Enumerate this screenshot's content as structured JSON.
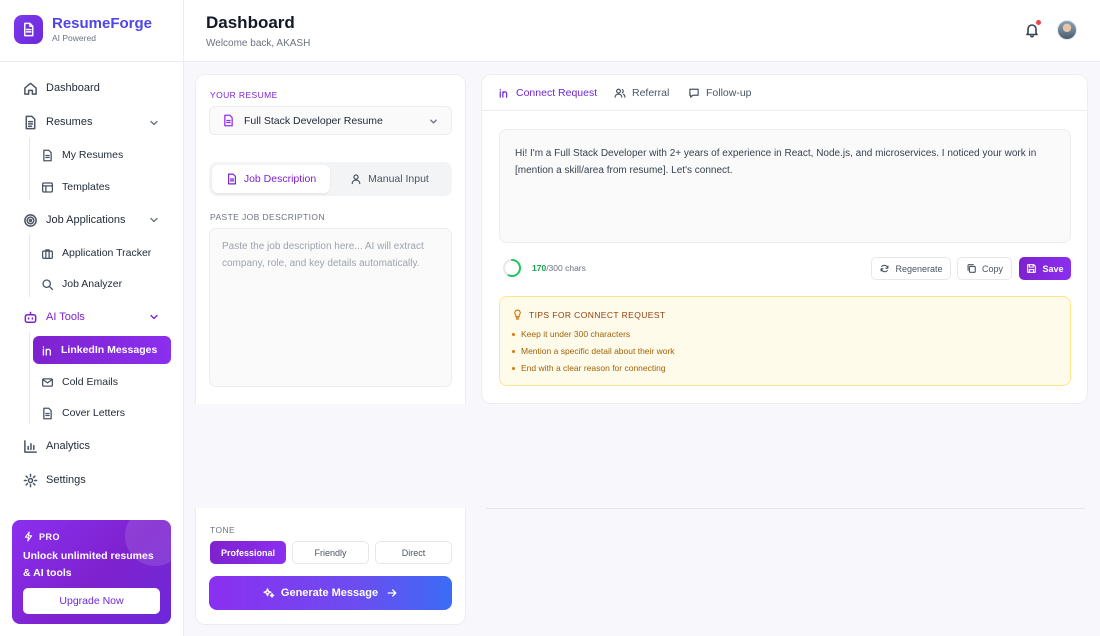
{
  "brand": {
    "name": "ResumeForge",
    "tagline": "AI Powered"
  },
  "sidebar": {
    "dashboard": "Dashboard",
    "resumes": "Resumes",
    "my_resumes": "My Resumes",
    "templates": "Templates",
    "job_applications": "Job Applications",
    "application_tracker": "Application Tracker",
    "job_analyzer": "Job Analyzer",
    "ai_tools": "AI Tools",
    "linkedin_messages": "LinkedIn Messages",
    "cold_emails": "Cold Emails",
    "cover_letters": "Cover Letters",
    "analytics": "Analytics",
    "settings": "Settings"
  },
  "pro": {
    "tag": "PRO",
    "text": "Unlock unlimited resumes & AI tools",
    "button": "Upgrade Now"
  },
  "header": {
    "title": "Dashboard",
    "subtitle": "Welcome back, AKASH"
  },
  "left": {
    "resume_label": "YOUR RESUME",
    "resume_selected": "Full Stack Developer Resume",
    "mode_job_description": "Job Description",
    "mode_manual_input": "Manual Input",
    "paste_label": "PASTE JOB DESCRIPTION",
    "paste_placeholder": "Paste the job description here... AI will extract company, role, and key details automatically.",
    "tone_label": "TONE",
    "tones": [
      "Professional",
      "Friendly",
      "Direct"
    ],
    "generate": "Generate Message"
  },
  "right": {
    "tabs": [
      "Connect Request",
      "Referral",
      "Follow-up"
    ],
    "message": "Hi! I'm a Full Stack Developer with 2+ years of experience in React, Node.js, and microservices. I noticed your work in [mention a skill/area from resume]. Let's connect.",
    "char_count": "170",
    "char_limit": "/300 chars",
    "char_fraction": 0.567,
    "regenerate": "Regenerate",
    "copy": "Copy",
    "save": "Save",
    "tips_title": "TIPS FOR CONNECT REQUEST",
    "tips": [
      "Keep it under 300 characters",
      "Mention a specific detail about their work",
      "End with a clear reason for connecting"
    ]
  },
  "colors": {
    "accent": "#7e22ce",
    "brand": "#4f46e5",
    "success": "#16a34a",
    "tips_bg": "#fffbeb"
  }
}
